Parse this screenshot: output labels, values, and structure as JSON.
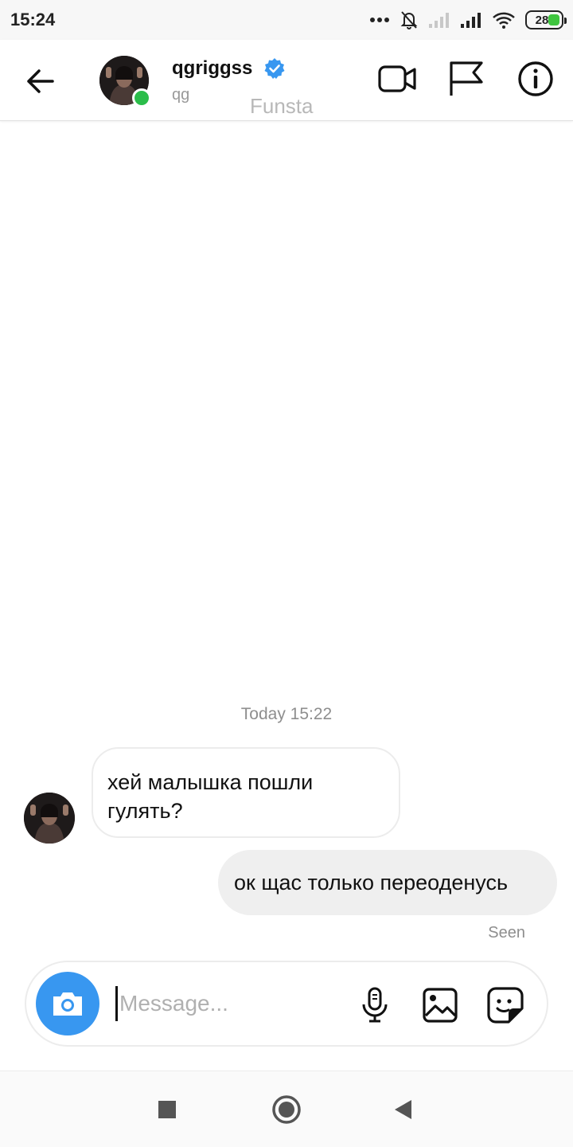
{
  "status_bar": {
    "time": "15:24",
    "battery_level": "28",
    "icons": [
      "more-dots-icon",
      "bell-muted-icon",
      "signal-empty-icon",
      "signal-full-icon",
      "wifi-icon",
      "battery-icon"
    ]
  },
  "header": {
    "back_icon": "arrow-left-icon",
    "username": "qgriggss",
    "verified": true,
    "subname": "qg",
    "overlay_label": "Funsta",
    "online": true,
    "actions": [
      "video-call-icon",
      "flag-icon",
      "info-icon"
    ]
  },
  "chat": {
    "timestamp": "Today 15:22",
    "messages": [
      {
        "from": "them",
        "text": "хей малышка пошли гулять?"
      },
      {
        "from": "me",
        "text": "ок щас только переоденусь"
      }
    ],
    "seen_label": "Seen"
  },
  "composer": {
    "placeholder": "Message...",
    "value": "",
    "actions": [
      "microphone-icon",
      "gallery-icon",
      "sticker-icon"
    ]
  },
  "nav_bar": {
    "buttons": [
      "recents-square-icon",
      "home-circle-icon",
      "back-triangle-icon"
    ]
  },
  "colors": {
    "accent": "#3897f0",
    "online": "#2bbd4a",
    "verified": "#3897f0",
    "incoming_border": "#ececec",
    "outgoing_bg": "#efefef"
  }
}
